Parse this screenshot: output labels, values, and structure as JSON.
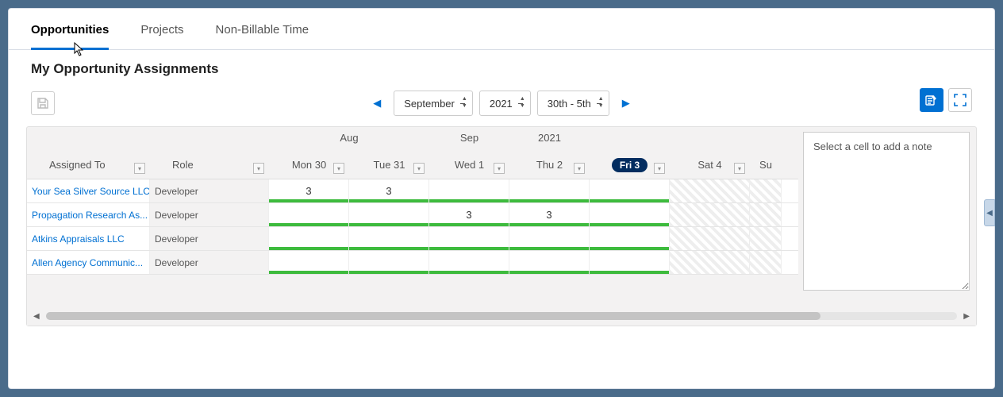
{
  "tabs": [
    "Opportunities",
    "Projects",
    "Non-Billable Time"
  ],
  "active_tab": 0,
  "title": "My Opportunity Assignments",
  "nav": {
    "month": "September",
    "year": "2021",
    "week": "30th - 5th"
  },
  "month_headers": {
    "aug": "Aug",
    "sep": "Sep",
    "year": "2021"
  },
  "columns": {
    "assigned_to": "Assigned To",
    "role": "Role",
    "days": [
      "Mon 30",
      "Tue 31",
      "Wed 1",
      "Thu 2",
      "Fri 3",
      "Sat 4",
      "Su"
    ],
    "today_index": 4
  },
  "rows": [
    {
      "assigned": "Your Sea Silver Source LLC",
      "role": "Developer",
      "values": [
        "3",
        "3",
        "",
        "",
        "",
        "",
        ""
      ]
    },
    {
      "assigned": "Propagation Research As...",
      "role": "Developer",
      "values": [
        "",
        "",
        "3",
        "3",
        "",
        "",
        ""
      ]
    },
    {
      "assigned": "Atkins Appraisals LLC",
      "role": "Developer",
      "values": [
        "",
        "",
        "",
        "",
        "",
        "",
        ""
      ]
    },
    {
      "assigned": "Allen Agency Communic...",
      "role": "Developer",
      "values": [
        "",
        "",
        "",
        "",
        "",
        "",
        ""
      ]
    }
  ],
  "note_placeholder": "Select a cell to add a note"
}
